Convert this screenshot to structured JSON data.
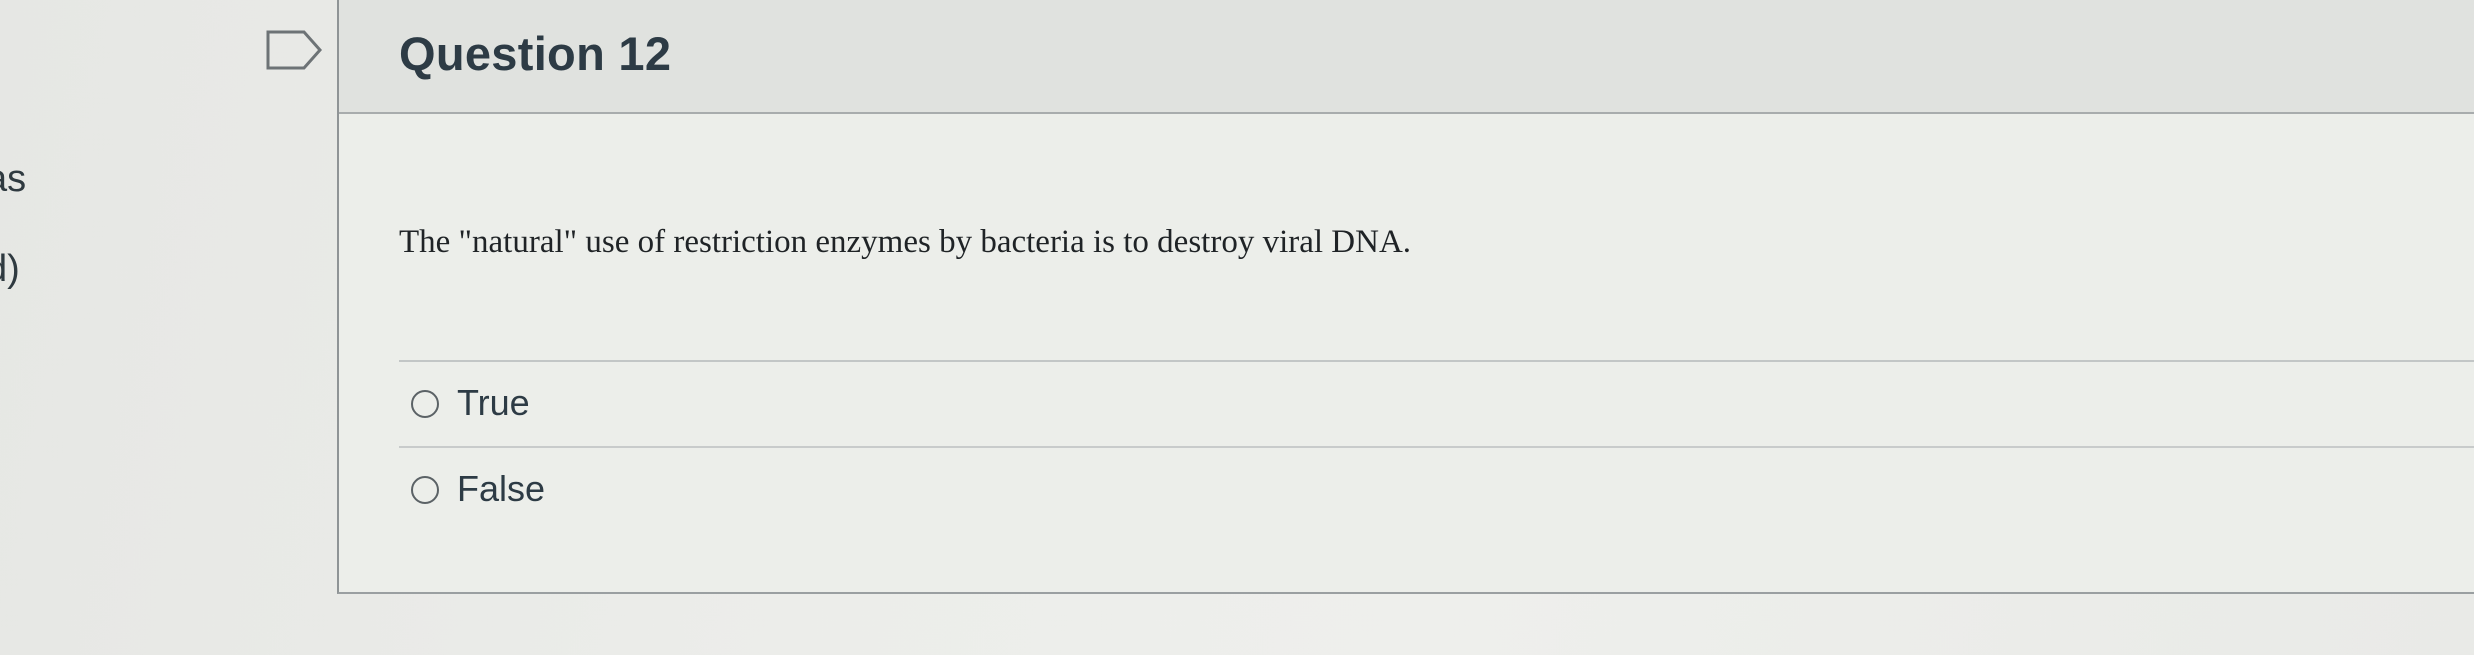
{
  "sidebar_fragment": {
    "lines": [
      "as",
      "d)"
    ]
  },
  "question": {
    "title": "Question 12",
    "text": "The \"natural\" use of restriction enzymes by bacteria is to destroy viral DNA.",
    "flag_icon": "bookmark-flag-icon",
    "answers": [
      {
        "label": "True",
        "selected": false
      },
      {
        "label": "False",
        "selected": false
      }
    ]
  },
  "colors": {
    "header_bg": "#e0e2df",
    "title_text": "#2d3b45",
    "body_bg": "#eceeea"
  }
}
